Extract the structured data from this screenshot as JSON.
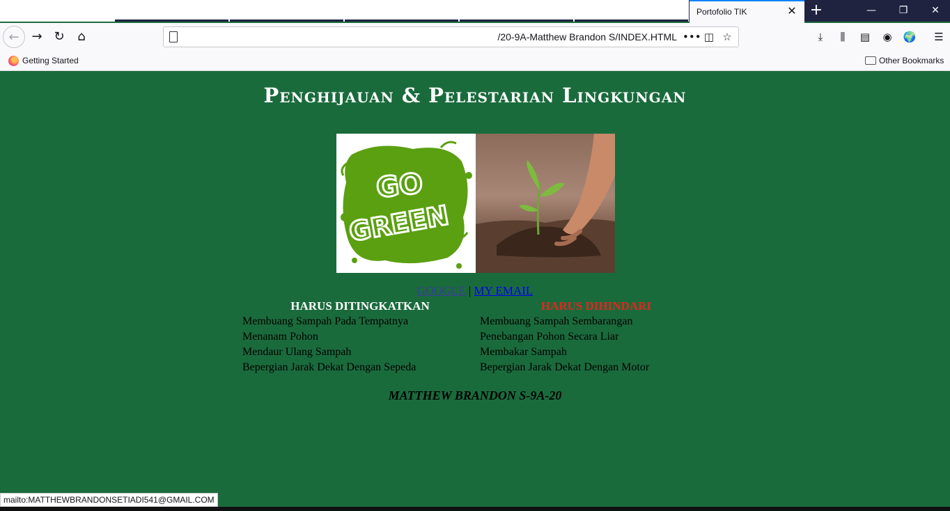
{
  "browser": {
    "tab_title": "Portofolio TIK",
    "url": "/20-9A-Matthew Brandon S/INDEX.HTML",
    "bookmarks": {
      "getting_started": "Getting Started",
      "other": "Other Bookmarks"
    },
    "status_text": "mailto:MATTHEWBRANDONSETIADI541@GMAIL.COM"
  },
  "page": {
    "title": "Penghijauan & Pelestarian Lingkungan",
    "images": {
      "left_text": [
        "GO",
        "GREEN"
      ]
    },
    "links": {
      "google": "GOOGLE",
      "separator": "|",
      "email": "MY EMAIL"
    },
    "columns": {
      "increase": {
        "heading": "HARUS DITINGKATKAN",
        "items": [
          "Membuang Sampah Pada Tempatnya",
          "Menanam Pohon",
          "Mendaur Ulang Sampah",
          "Bepergian Jarak Dekat Dengan Sepeda"
        ]
      },
      "avoid": {
        "heading": "HARUS DIHINDARI",
        "items": [
          "Membuang Sampah Sembarangan",
          "Penebangan Pohon Secara Liar",
          "Membakar Sampah",
          "Bepergian Jarak Dekat Dengan Motor"
        ]
      }
    },
    "footer": "MATTHEW BRANDON S-9A-20"
  },
  "colors": {
    "background": "#1a6b3c",
    "avoid_heading": "#e8231c",
    "increase_heading": "#ffffff",
    "go_green": "#5aa011"
  }
}
